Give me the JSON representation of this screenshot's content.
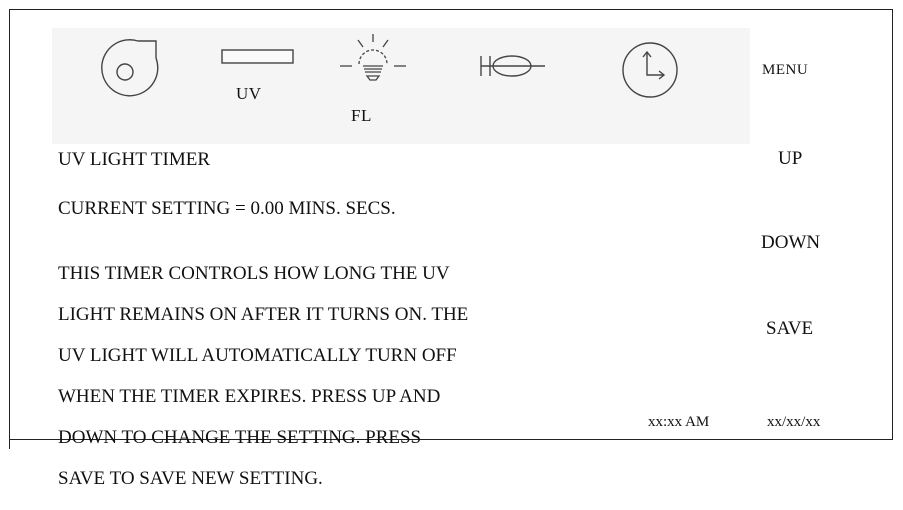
{
  "icons": {
    "fan": "blower-fan-icon",
    "uv": "uv-lamp-icon",
    "uv_label": "UV",
    "fl": "bulb-icon",
    "fl_label": "FL",
    "damper": "damper-icon",
    "clock": "clock-icon"
  },
  "menu": {
    "menu_label": "MENU",
    "up_label": "UP",
    "down_label": "DOWN",
    "save_label": "SAVE"
  },
  "screen": {
    "title": "UV LIGHT TIMER",
    "current_setting": "CURRENT SETTING = 0.00 MINS. SECS.",
    "description_lines": [
      "THIS TIMER CONTROLS HOW LONG THE UV",
      "LIGHT REMAINS ON AFTER IT TURNS ON.  THE",
      "UV LIGHT WILL AUTOMATICALLY TURN OFF",
      "WHEN THE TIMER EXPIRES.  PRESS UP AND",
      "DOWN TO CHANGE THE SETTING.  PRESS",
      "SAVE TO SAVE NEW SETTING."
    ]
  },
  "status": {
    "time": "xx:xx AM",
    "date": "xx/xx/xx"
  },
  "colors": {
    "line": "#222222",
    "icon_bar_bg": "#f5f5f5",
    "text": "#111111"
  }
}
